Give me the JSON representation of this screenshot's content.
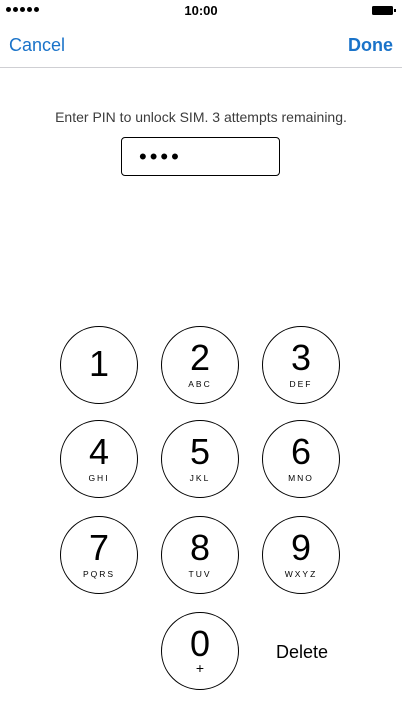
{
  "status_bar": {
    "time": "10:00"
  },
  "nav": {
    "cancel_label": "Cancel",
    "done_label": "Done"
  },
  "prompt": "Enter PIN to unlock SIM. 3 attempts remaining.",
  "pin_field": {
    "masked_value": "••••"
  },
  "keypad": {
    "keys": [
      {
        "digit": "1",
        "letters": ""
      },
      {
        "digit": "2",
        "letters": "ABC"
      },
      {
        "digit": "3",
        "letters": "DEF"
      },
      {
        "digit": "4",
        "letters": "GHI"
      },
      {
        "digit": "5",
        "letters": "JKL"
      },
      {
        "digit": "6",
        "letters": "MNO"
      },
      {
        "digit": "7",
        "letters": "PQRS"
      },
      {
        "digit": "8",
        "letters": "TUV"
      },
      {
        "digit": "9",
        "letters": "WXYZ"
      },
      {
        "digit": "0",
        "letters": "+"
      }
    ],
    "delete_label": "Delete"
  },
  "colors": {
    "accent": "#1a73c9"
  },
  "icons": [
    "signal-strength-icon",
    "battery-icon"
  ]
}
